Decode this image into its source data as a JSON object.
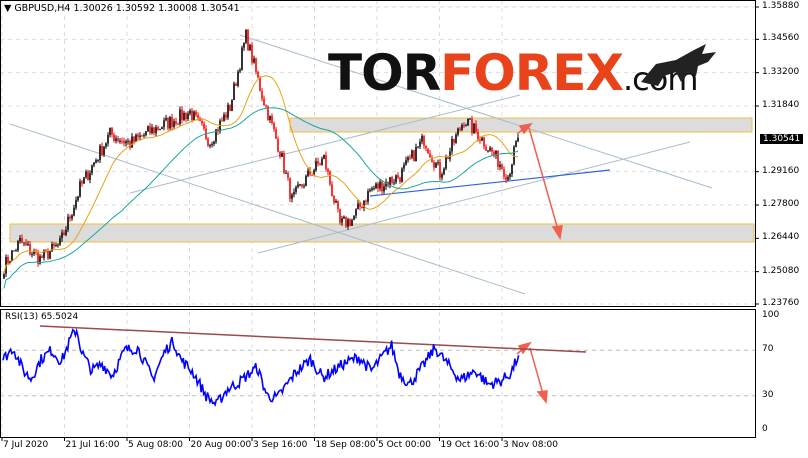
{
  "header": {
    "symbol_info": "▼ GBPUSD,H4  1.30026 1.30592 1.30008 1.30541"
  },
  "logo": {
    "part1": "TOR",
    "part2": "FOREX",
    "part3": ".com"
  },
  "colors": {
    "bull": "#000000",
    "bear": "#ff0000",
    "ma_fast": "#e8a317",
    "ma_slow": "#1aa6a0",
    "rsi": "#0000ff",
    "trend": "#a8bccc",
    "zone": "#f0c040",
    "arrow": "#f06050",
    "rsi_trend": "#9b4a4a",
    "support": "#3060e0"
  },
  "chart_data": [
    {
      "type": "candlestick",
      "title": "GBPUSD,H4",
      "ohlc_last": {
        "open": 1.30026,
        "high": 1.30592,
        "low": 1.30008,
        "close": 1.30541
      },
      "current_price_label": "1.30541",
      "ylim": [
        1.2376,
        1.3588
      ],
      "y_ticks": [
        "1.35880",
        "1.34560",
        "1.33200",
        "1.31840",
        "1.29160",
        "1.27800",
        "1.26440",
        "1.25080",
        "1.23760"
      ],
      "x_ticks": [
        "7 Jul 2020",
        "21 Jul 16:00",
        "5 Aug 08:00",
        "20 Aug 00:00",
        "3 Sep 16:00",
        "18 Sep 08:00",
        "5 Oct 00:00",
        "19 Oct 16:00",
        "3 Nov 08:00"
      ],
      "close_path": [
        [
          0,
          1.253
        ],
        [
          8,
          1.263
        ],
        [
          18,
          1.256
        ],
        [
          28,
          1.262
        ],
        [
          38,
          1.285
        ],
        [
          53,
          1.307
        ],
        [
          63,
          1.303
        ],
        [
          73,
          1.308
        ],
        [
          93,
          1.316
        ],
        [
          103,
          1.304
        ],
        [
          113,
          1.318
        ],
        [
          121,
          1.347
        ],
        [
          129,
          1.323
        ],
        [
          138,
          1.3
        ],
        [
          144,
          1.28
        ],
        [
          153,
          1.291
        ],
        [
          160,
          1.297
        ],
        [
          168,
          1.27
        ],
        [
          174,
          1.272
        ],
        [
          183,
          1.284
        ],
        [
          198,
          1.29
        ],
        [
          210,
          1.305
        ],
        [
          218,
          1.291
        ],
        [
          230,
          1.313
        ],
        [
          238,
          1.306
        ],
        [
          248,
          1.295
        ],
        [
          252,
          1.29
        ],
        [
          257,
          1.3054
        ]
      ],
      "resistance_zone": [
        1.3085,
        1.312
      ],
      "support_zone": [
        1.265,
        1.27
      ]
    },
    {
      "type": "line",
      "title": "RSI(13) 65.5024",
      "ylim": [
        0,
        100
      ],
      "y_ticks": [
        "100",
        "70",
        "30",
        "0"
      ],
      "rsi_path": [
        [
          0,
          62
        ],
        [
          8,
          72
        ],
        [
          16,
          52
        ],
        [
          22,
          45
        ],
        [
          30,
          62
        ],
        [
          38,
          70
        ],
        [
          46,
          60
        ],
        [
          54,
          82
        ],
        [
          58,
          88
        ],
        [
          62,
          68
        ],
        [
          70,
          52
        ],
        [
          78,
          58
        ],
        [
          86,
          48
        ],
        [
          96,
          70
        ],
        [
          106,
          72
        ],
        [
          118,
          45
        ],
        [
          128,
          70
        ],
        [
          134,
          78
        ],
        [
          140,
          62
        ],
        [
          150,
          50
        ],
        [
          160,
          30
        ],
        [
          168,
          22
        ],
        [
          176,
          35
        ],
        [
          186,
          42
        ],
        [
          200,
          55
        ],
        [
          208,
          30
        ],
        [
          216,
          28
        ],
        [
          230,
          50
        ],
        [
          242,
          62
        ],
        [
          252,
          46
        ],
        [
          268,
          58
        ],
        [
          280,
          64
        ],
        [
          290,
          52
        ],
        [
          300,
          66
        ],
        [
          306,
          74
        ],
        [
          312,
          50
        ],
        [
          320,
          40
        ],
        [
          330,
          55
        ],
        [
          340,
          72
        ],
        [
          350,
          58
        ],
        [
          360,
          44
        ],
        [
          372,
          52
        ],
        [
          382,
          40
        ],
        [
          392,
          43
        ],
        [
          400,
          50
        ],
        [
          406,
          65.5
        ]
      ]
    }
  ]
}
